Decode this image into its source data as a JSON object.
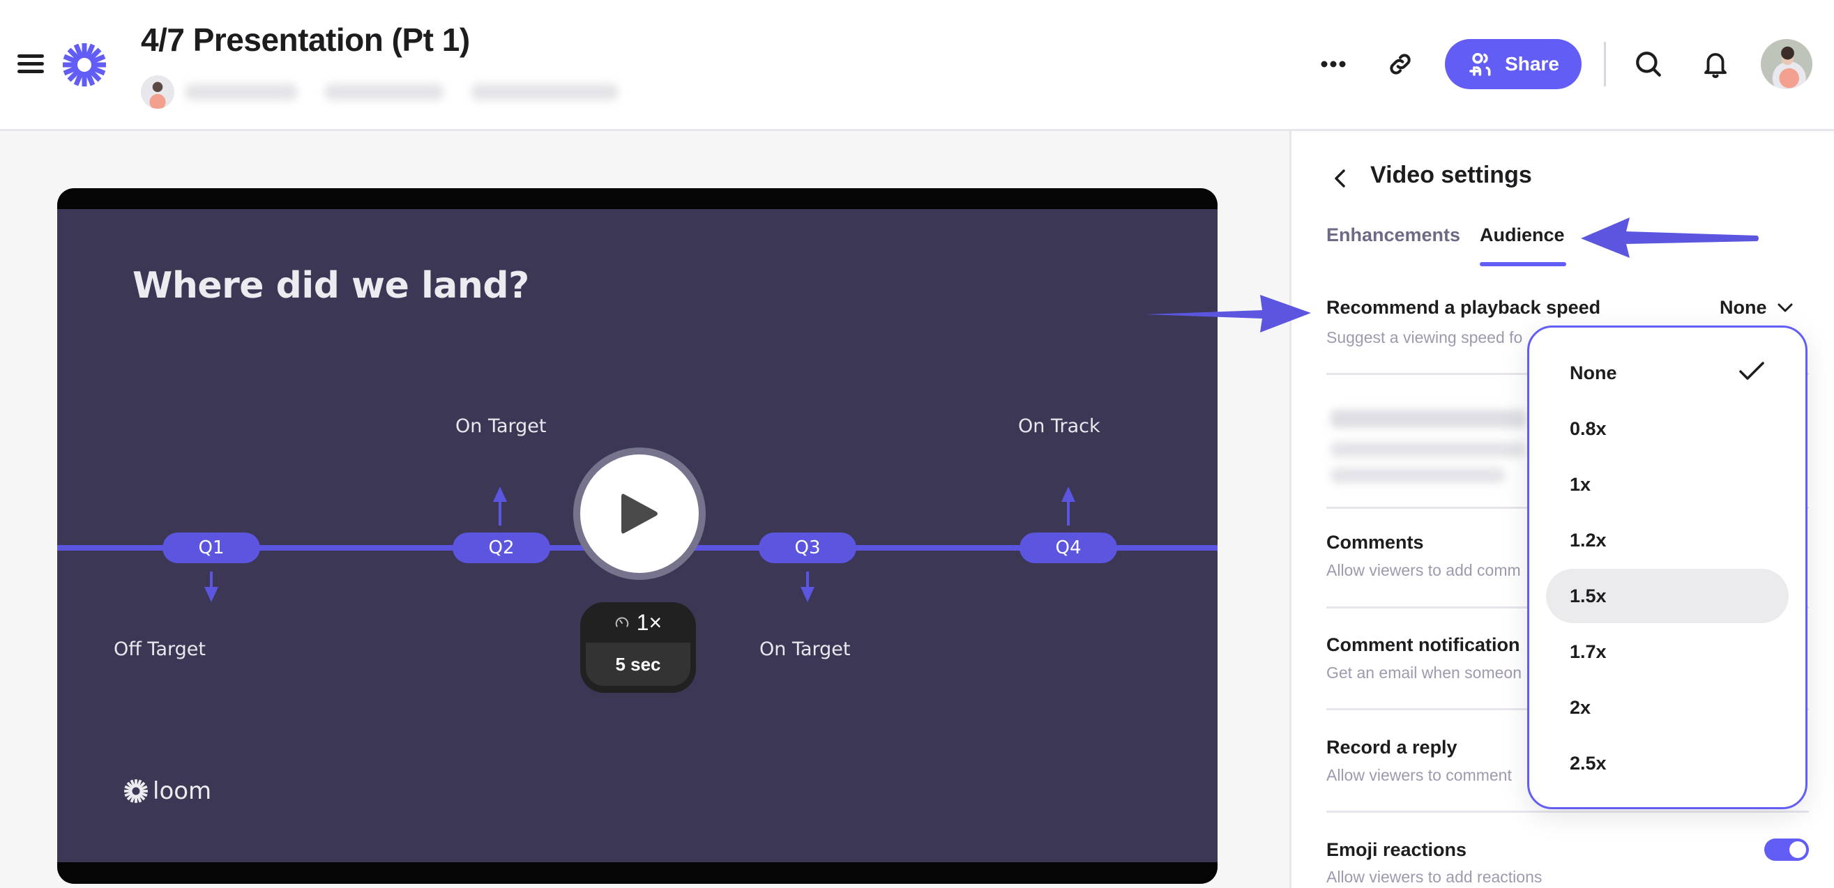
{
  "header": {
    "title": "4/7 Presentation (Pt 1)",
    "share_label": "Share",
    "icons": [
      "menu-icon",
      "loom-logo-icon",
      "more-icon",
      "link-icon",
      "add-people-icon",
      "search-icon",
      "bell-icon"
    ]
  },
  "video": {
    "slide_title": "Where did we land?",
    "quarters": [
      {
        "label": "Q1",
        "status": "Off Target",
        "direction": "down"
      },
      {
        "label": "Q2",
        "status": "On Target",
        "direction": "up"
      },
      {
        "label": "Q3",
        "status": "On Target",
        "direction": "down"
      },
      {
        "label": "Q4",
        "status": "On Track",
        "direction": "up"
      }
    ],
    "speed": "1×",
    "duration": "5 sec",
    "watermark": "loom"
  },
  "panel": {
    "title": "Video settings",
    "tabs": [
      {
        "label": "Enhancements",
        "active": false
      },
      {
        "label": "Audience",
        "active": true
      }
    ],
    "settings": [
      {
        "title": "Recommend a playback speed",
        "subtitle": "Suggest a viewing speed fo",
        "value": "None"
      },
      {
        "title": "Comments",
        "subtitle": "Allow viewers to add comm"
      },
      {
        "title": "Comment notification",
        "subtitle": "Get an email when someon"
      },
      {
        "title": "Record a reply",
        "subtitle": "Allow viewers to comment"
      },
      {
        "title": "Emoji reactions",
        "subtitle": "Allow viewers to add reactions",
        "enabled": true
      }
    ]
  },
  "dropdown": {
    "options": [
      "None",
      "0.8x",
      "1x",
      "1.2x",
      "1.5x",
      "1.7x",
      "2x",
      "2.5x"
    ],
    "selected": "None",
    "hovered": "1.5x"
  },
  "colors": {
    "accent": "#625df5",
    "slide_bg": "#3b3754",
    "timeline": "#5b55df"
  }
}
